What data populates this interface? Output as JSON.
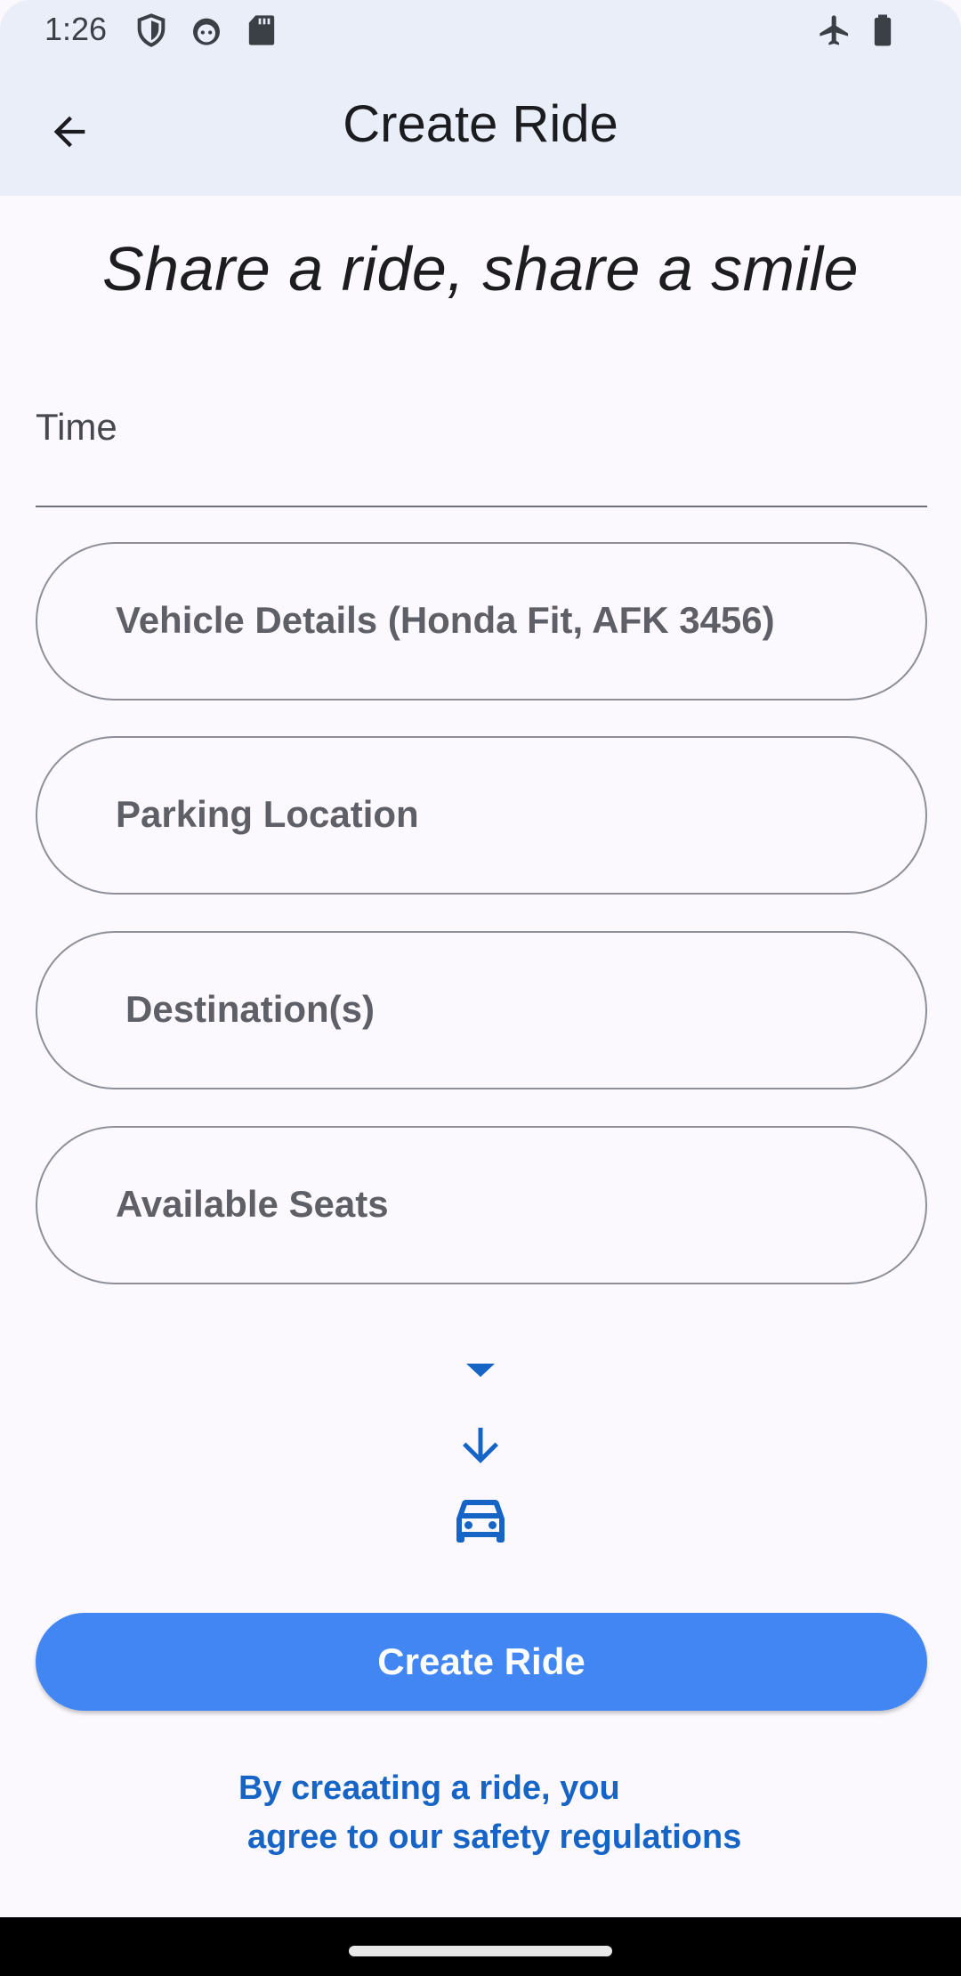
{
  "status_bar": {
    "time": "1:26",
    "left_icons": [
      "shield-icon",
      "android-face-icon",
      "sd-card-icon"
    ],
    "right_icons": [
      "airplane-mode-icon",
      "battery-icon"
    ]
  },
  "app_bar": {
    "title": "Create Ride",
    "back_icon": "arrow-back-icon"
  },
  "tagline": "Share a ride, share a smile",
  "form": {
    "time_label": "Time",
    "vehicle_placeholder": "Vehicle Details (Honda Fit, AFK 3456)",
    "parking_placeholder": "Parking Location",
    "destination_placeholder": "Destination(s)",
    "seats_placeholder": "Available Seats"
  },
  "decor_icons": [
    "caret-down-icon",
    "arrow-down-icon",
    "car-icon"
  ],
  "accent_color": "#1665c6",
  "button": {
    "label": "Create Ride",
    "color": "#4286f4"
  },
  "footer": {
    "agree_line1": "By creaating a ride, you",
    "agree_line2": "agree to our safety regulations"
  }
}
